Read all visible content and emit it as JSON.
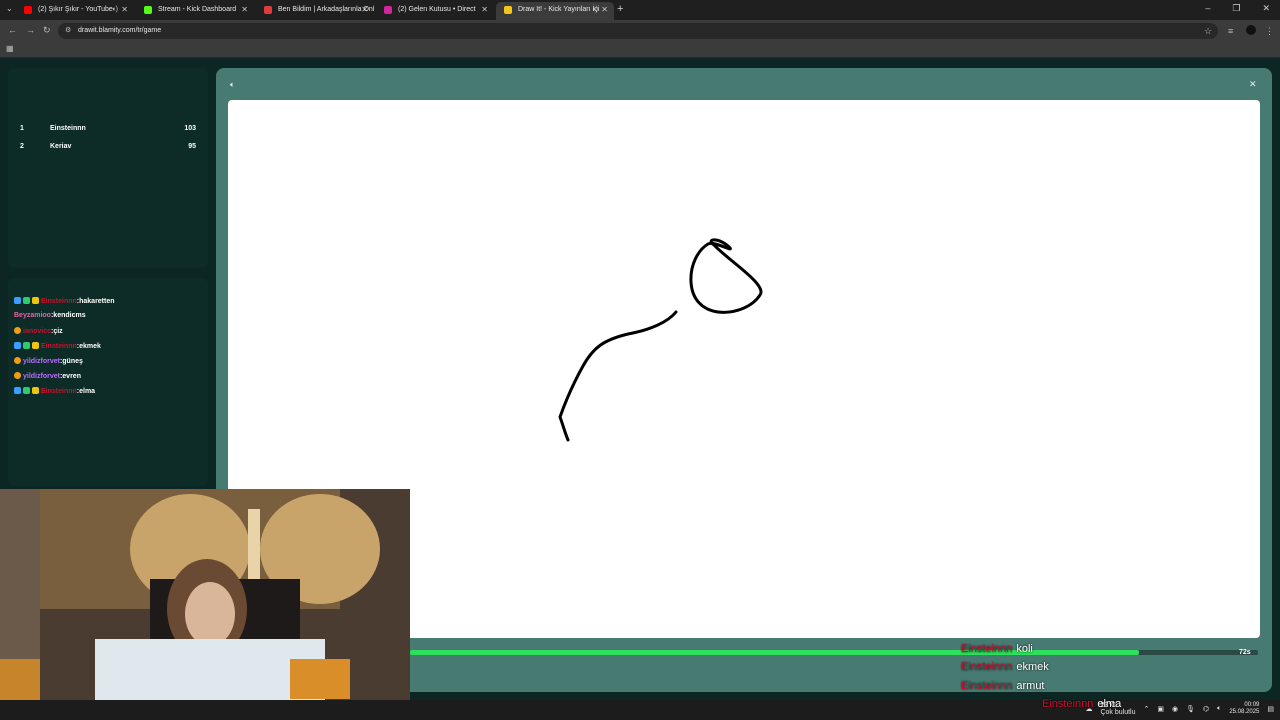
{
  "browser": {
    "tabs": [
      {
        "label": "(2) Şıkır Şıkır - YouTube",
        "favicon_color": "#ff0000",
        "sound": true
      },
      {
        "label": "Stream - Kick Dashboard",
        "favicon_color": "#53fc18",
        "sound": false
      },
      {
        "label": "Ben Bildim | Arkadaşlarınla Onl",
        "favicon_color": "#e23b3b",
        "sound": false
      },
      {
        "label": "(2) Gelen Kutusu • Direct",
        "favicon_color": "#d6249f",
        "sound": false
      },
      {
        "label": "Draw It! - Kick Yayınları İçi",
        "favicon_color": "#f5c518",
        "sound": true
      }
    ],
    "url": "drawit.blamity.com/tr/game"
  },
  "leaderboard": [
    {
      "rank": "1",
      "name": "Einsteinnn",
      "score": "103"
    },
    {
      "rank": "2",
      "name": "Keriav",
      "score": "95"
    }
  ],
  "chat": [
    {
      "user": "Einsteinnn",
      "message": ":hakaretten",
      "user_color": "#c4122f",
      "badges": [
        "sword",
        "mod",
        "crown"
      ]
    },
    {
      "user": "Beyzamioo",
      "message": ":kendicms",
      "user_color": "#f25da7",
      "badges": []
    },
    {
      "user": "ianovicc",
      "message": ":çiz",
      "user_color": "#c4122f",
      "badges": [
        "coin"
      ]
    },
    {
      "user": "Einsteinnn",
      "message": ":ekmek",
      "user_color": "#c4122f",
      "badges": [
        "sword",
        "mod",
        "crown"
      ]
    },
    {
      "user": "yildizforvet",
      "message": ":güneş",
      "user_color": "#b86bff",
      "badges": [
        "coin"
      ]
    },
    {
      "user": "yildizforvet",
      "message": ":evren",
      "user_color": "#b86bff",
      "badges": [
        "coin"
      ]
    },
    {
      "user": "Einsteinnn",
      "message": ":elma",
      "user_color": "#c4122f",
      "badges": [
        "sword",
        "mod",
        "crown"
      ]
    }
  ],
  "game": {
    "timer_text": "72s",
    "timer_progress": 0.86
  },
  "overlay_chat": [
    {
      "user": "Einsteinnn",
      "message": "koli"
    },
    {
      "user": "Einsteinnn",
      "message": "ekmek"
    },
    {
      "user": "Einsteinnn",
      "message": "armut"
    },
    {
      "user": "Einsteinnn",
      "message": "elma"
    }
  ],
  "taskbar": {
    "weather": "23°C",
    "weather_desc": "Çok bulutlu",
    "time": "00:09",
    "date": "25.08.2025"
  }
}
